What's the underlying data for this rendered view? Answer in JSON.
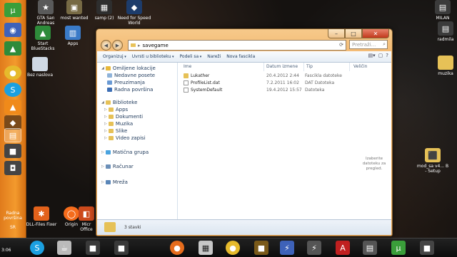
{
  "desktop": {
    "top_icons": [
      {
        "label": "GTA San Andreas",
        "icon": "gta-icon",
        "color": "#5a5a5a"
      },
      {
        "label": "most wanted",
        "icon": "nfs-mw-icon",
        "color": "#776a44"
      },
      {
        "label": "samp (2)",
        "icon": "samp-icon",
        "color": "#2e2e2e"
      },
      {
        "label": "Need for Speed World",
        "icon": "nfs-world-icon",
        "color": "#1d3c6b"
      },
      {
        "label": "MILAN",
        "icon": "user-folder-icon",
        "color": "#3b3b3b"
      }
    ],
    "left_icons": [
      {
        "label": "Start BlueStacks",
        "icon": "bluestacks-icon",
        "color": "#2e8b3a"
      },
      {
        "label": "Apps",
        "icon": "apps-icon",
        "color": "#3a7bc8"
      },
      {
        "label": "Bez naslova",
        "icon": "image-file-icon",
        "color": "#cfd8e3"
      },
      {
        "label": "DLL-Files Fixer",
        "icon": "gear-icon",
        "color": "#e2621b"
      },
      {
        "label": "Origin",
        "icon": "origin-icon",
        "color": "#f56c1c"
      },
      {
        "label": "Micr Office",
        "icon": "office-icon",
        "color": "#cc4a1c"
      }
    ],
    "right_icons": [
      {
        "label": "radmila",
        "icon": "user-folder-icon",
        "color": "#3b3b3b"
      },
      {
        "label": "muzika",
        "icon": "folder-icon",
        "color": "#e6c157"
      },
      {
        "label": "mod_sa v4... B - Setup",
        "icon": "setup-icon",
        "color": "#e6c157"
      }
    ]
  },
  "side_taskbar": {
    "bottom_label_1": "Radna površina",
    "bottom_label_2": "SR",
    "buttons": [
      {
        "icon": "utorrent-icon",
        "color": "#3a9e3a"
      },
      {
        "icon": "internet-icon",
        "color": "#3e62b9"
      },
      {
        "icon": "bluestacks-icon",
        "color": "#2e8b3a"
      },
      {
        "icon": "chrome-icon",
        "color": "#e6ba2c"
      },
      {
        "icon": "skype-icon",
        "color": "#1ba0e1"
      },
      {
        "icon": "vlc-icon",
        "color": "#f08a1a"
      },
      {
        "icon": "game-icon",
        "color": "#7a4a1a"
      },
      {
        "icon": "explorer-icon",
        "color": "#e6c157"
      },
      {
        "icon": "media-icon",
        "color": "#444"
      },
      {
        "icon": "app-icon",
        "color": "#444"
      }
    ]
  },
  "bottom_taskbar": {
    "clock_time": "3:06",
    "icons": [
      {
        "icon": "skype-icon",
        "color": "#1ba0e1"
      },
      {
        "icon": "java-icon",
        "color": "#bbb"
      },
      {
        "icon": "app-icon",
        "color": "#3a3a3a"
      },
      {
        "icon": "app-icon",
        "color": "#3a3a3a"
      },
      {
        "icon": "firefox-icon",
        "color": "#e66c1c"
      },
      {
        "icon": "calendar-icon",
        "color": "#c8c8c8"
      },
      {
        "icon": "chrome-icon",
        "color": "#e6ba2c"
      },
      {
        "icon": "app-icon",
        "color": "#7a5a1a"
      },
      {
        "icon": "daemon-icon",
        "color": "#3e62b9"
      },
      {
        "icon": "pdf-icon",
        "color": "#c02020"
      },
      {
        "icon": "network-icon",
        "color": "#555"
      },
      {
        "icon": "utorrent-icon",
        "color": "#3a9e3a"
      },
      {
        "icon": "app-icon",
        "color": "#444"
      }
    ]
  },
  "window": {
    "address": {
      "path": "savegame",
      "search_placeholder": "Pretraži..."
    },
    "toolbar": [
      {
        "label": "Organizuj",
        "dropdown": true
      },
      {
        "label": "Uvrsti u biblioteku",
        "dropdown": true
      },
      {
        "label": "Podeli sa",
        "dropdown": true
      },
      {
        "label": "Nareži",
        "dropdown": false
      },
      {
        "label": "Nova fascikla",
        "dropdown": false
      }
    ],
    "nav_pane": {
      "favorites_header": "Omiljene lokacije",
      "favorites": [
        "Nedavne posete",
        "Preuzimanja",
        "Radna površina"
      ],
      "libraries_header": "Biblioteke",
      "libraries": [
        "Apps",
        "Dokumenti",
        "Muzika",
        "Slike",
        "Video zapisi"
      ],
      "homegroup": "Matična grupa",
      "computer": "Računar",
      "network": "Mreža"
    },
    "columns": {
      "name": "Ime",
      "date": "Datum izmene",
      "type": "Tip",
      "size": "Veličin"
    },
    "files": [
      {
        "name": "Lukather",
        "date": "20.4.2012 2:44",
        "type": "Fascikla datoteke",
        "kind": "folder"
      },
      {
        "name": "ProfileList.dat",
        "date": "7.2.2011 16:02",
        "type": "DAT Datoteka",
        "kind": "doc"
      },
      {
        "name": "SystemDefault",
        "date": "19.4.2012 15:57",
        "type": "Datoteka",
        "kind": "doc"
      }
    ],
    "preview_message": "Izaberite datoteku za pregled.",
    "status_text": "3 stavki"
  },
  "colors": {
    "accent": "#f39a2d",
    "window_frame": "#f2b063",
    "link_text": "#1e395b"
  }
}
